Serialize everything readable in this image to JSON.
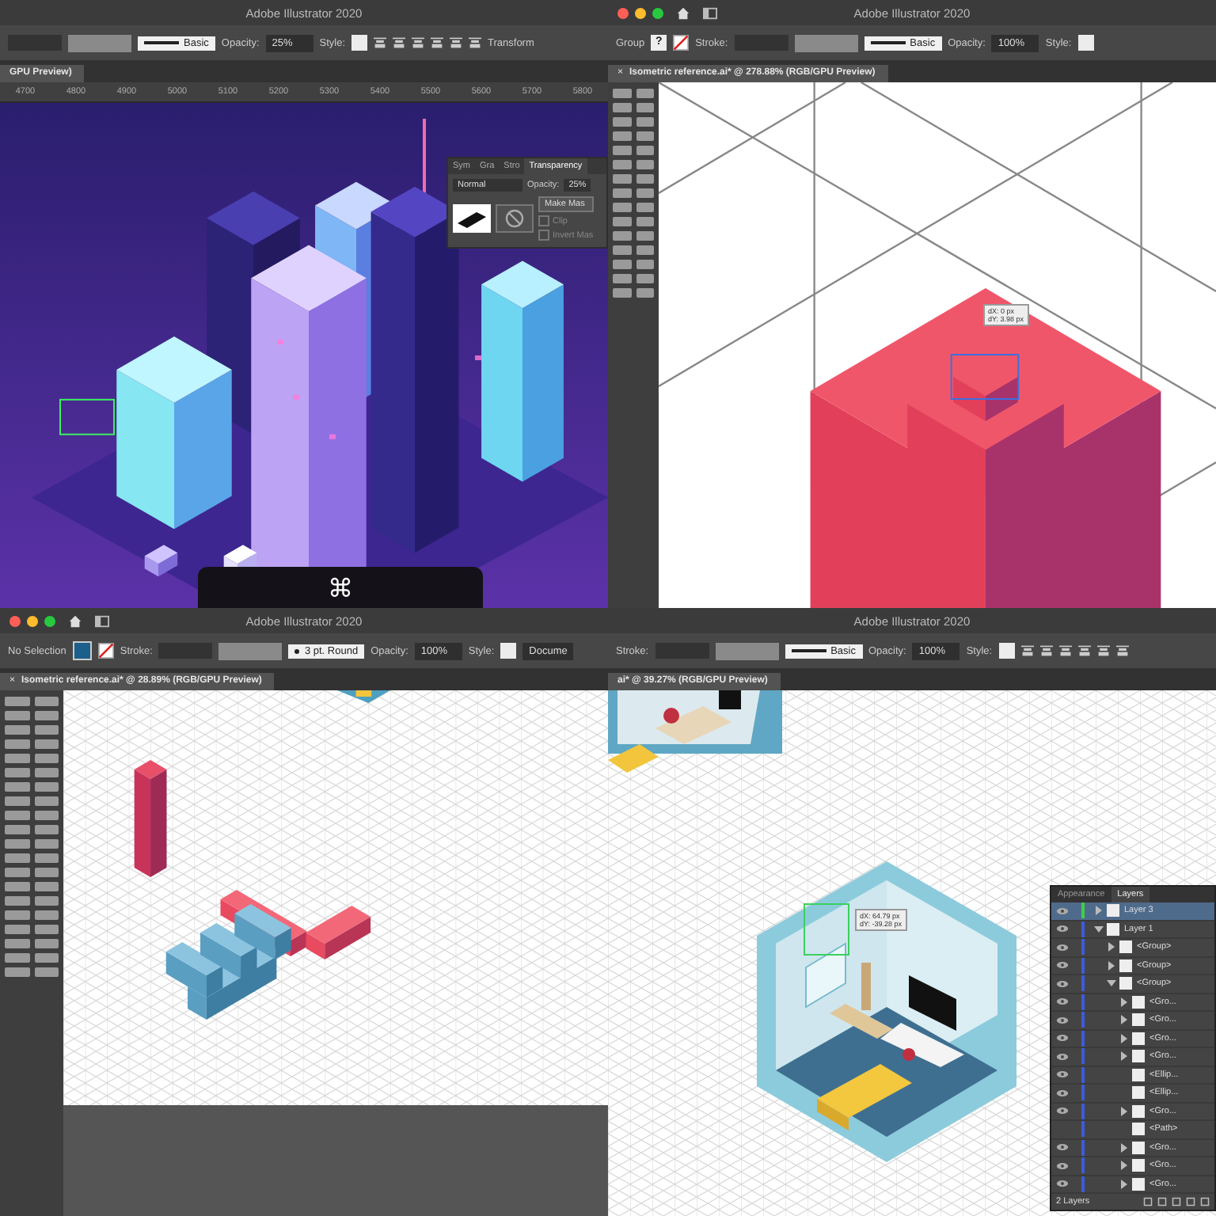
{
  "panes": [
    {
      "title": "Adobe Illustrator 2020",
      "window_controls": false,
      "controls": [
        {
          "kind": "empty-field"
        },
        {
          "kind": "grey-field"
        },
        {
          "kind": "stroke",
          "text": "Basic"
        },
        {
          "kind": "text",
          "text": "Opacity:"
        },
        {
          "kind": "field",
          "text": "25%"
        },
        {
          "kind": "text",
          "text": "Style:"
        },
        {
          "kind": "style-swatch"
        },
        {
          "kind": "align-icons"
        },
        {
          "kind": "text",
          "text": "Transform"
        }
      ],
      "tab": {
        "label": "GPU Preview)"
      },
      "ruler": [
        "4700",
        "4800",
        "4900",
        "5000",
        "5100",
        "5200",
        "5300",
        "5400",
        "5500",
        "5600",
        "5700",
        "5800"
      ],
      "kind": "city",
      "transparency": {
        "tabs": [
          {
            "label": "Sym",
            "selected": false
          },
          {
            "label": "Gra",
            "selected": false
          },
          {
            "label": "Stro",
            "selected": false
          },
          {
            "label": "Transparency",
            "selected": true
          }
        ],
        "blend": "Normal",
        "opacity_label": "Opacity:",
        "opacity": "25%",
        "mask_button": "Make Mas",
        "options": [
          {
            "label": "Clip",
            "checked": false
          },
          {
            "label": "Invert Mas",
            "checked": false
          }
        ]
      },
      "key_hint": "⌘"
    },
    {
      "title": "Adobe Illustrator 2020",
      "window_controls": true,
      "controls": [
        {
          "kind": "text",
          "text": "Group"
        },
        {
          "kind": "unknown-swatch",
          "text": "?"
        },
        {
          "kind": "none-swatch"
        },
        {
          "kind": "text",
          "text": "Stroke:"
        },
        {
          "kind": "empty-field"
        },
        {
          "kind": "grey-field"
        },
        {
          "kind": "stroke",
          "text": "Basic"
        },
        {
          "kind": "text",
          "text": "Opacity:"
        },
        {
          "kind": "field",
          "text": "100%"
        },
        {
          "kind": "text",
          "text": "Style:"
        },
        {
          "kind": "style-swatch"
        }
      ],
      "tab": {
        "close": "×",
        "label": "Isometric reference.ai* @ 278.88% (RGB/GPU Preview)"
      },
      "kind": "closeup",
      "tooltip": [
        "dX: 0 px",
        "dY: 3.98 px"
      ]
    },
    {
      "title": "Adobe Illustrator 2020",
      "window_controls": true,
      "controls": [
        {
          "kind": "text",
          "text": "No Selection"
        },
        {
          "kind": "fill-swatch"
        },
        {
          "kind": "none-swatch"
        },
        {
          "kind": "text",
          "text": "Stroke:"
        },
        {
          "kind": "empty-field"
        },
        {
          "kind": "grey-field"
        },
        {
          "kind": "stroke-round",
          "text": "3 pt. Round"
        },
        {
          "kind": "text",
          "text": "Opacity:"
        },
        {
          "kind": "field",
          "text": "100%"
        },
        {
          "kind": "text",
          "text": "Style:"
        },
        {
          "kind": "style-swatch"
        },
        {
          "kind": "field",
          "text": "Docume"
        }
      ],
      "tab": {
        "close": "×",
        "label": "Isometric reference.ai* @ 28.89% (RGB/GPU Preview)"
      },
      "kind": "letters"
    },
    {
      "title": "Adobe Illustrator 2020",
      "window_controls": false,
      "controls": [
        {
          "kind": "text",
          "text": "Stroke:"
        },
        {
          "kind": "empty-field"
        },
        {
          "kind": "grey-field"
        },
        {
          "kind": "stroke",
          "text": "Basic"
        },
        {
          "kind": "text",
          "text": "Opacity:"
        },
        {
          "kind": "field",
          "text": "100%"
        },
        {
          "kind": "text",
          "text": "Style:"
        },
        {
          "kind": "style-swatch"
        },
        {
          "kind": "align-icons"
        }
      ],
      "tab": {
        "label": "ai* @ 39.27% (RGB/GPU Preview)"
      },
      "kind": "room",
      "tooltip": [
        "dX: 64.79 px",
        "dY: -39.28 px"
      ],
      "layers": {
        "tabs": [
          {
            "label": "Appearance",
            "selected": false
          },
          {
            "label": "Layers",
            "selected": true
          }
        ],
        "items": [
          {
            "name": "Layer 3",
            "kind": "group",
            "expanded": false,
            "visible": true,
            "selected": true,
            "color": "#3ecf4a"
          },
          {
            "name": "Layer 1",
            "kind": "group",
            "expanded": true,
            "visible": true,
            "selected": false,
            "color": "#3b5bdb",
            "children": [
              {
                "name": "<Group>",
                "kind": "group",
                "expanded": false,
                "visible": true,
                "selected": false
              },
              {
                "name": "<Group>",
                "kind": "group",
                "expanded": false,
                "visible": true,
                "selected": false
              },
              {
                "name": "<Group>",
                "kind": "group",
                "expanded": true,
                "visible": true,
                "selected": false,
                "children": [
                  {
                    "name": "<Gro...",
                    "kind": "group",
                    "expanded": false,
                    "visible": true,
                    "selected": false
                  },
                  {
                    "name": "<Gro...",
                    "kind": "group",
                    "expanded": false,
                    "visible": true,
                    "selected": false
                  },
                  {
                    "name": "<Gro...",
                    "kind": "group",
                    "expanded": false,
                    "visible": true,
                    "selected": false
                  },
                  {
                    "name": "<Gro...",
                    "kind": "group",
                    "expanded": false,
                    "visible": true,
                    "selected": false
                  },
                  {
                    "name": "<Ellip...",
                    "kind": "object",
                    "visible": true,
                    "selected": false
                  },
                  {
                    "name": "<Ellip...",
                    "kind": "object",
                    "visible": true,
                    "selected": false
                  },
                  {
                    "name": "<Gro...",
                    "kind": "group",
                    "expanded": false,
                    "visible": true,
                    "selected": false
                  },
                  {
                    "name": "<Path>",
                    "kind": "object",
                    "visible": false,
                    "selected": false
                  },
                  {
                    "name": "<Gro...",
                    "kind": "group",
                    "expanded": false,
                    "visible": true,
                    "selected": false
                  },
                  {
                    "name": "<Gro...",
                    "kind": "group",
                    "expanded": false,
                    "visible": true,
                    "selected": false
                  },
                  {
                    "name": "<Gro...",
                    "kind": "group",
                    "expanded": false,
                    "visible": true,
                    "selected": false
                  }
                ]
              }
            ]
          }
        ],
        "footer": "2 Layers"
      }
    }
  ]
}
